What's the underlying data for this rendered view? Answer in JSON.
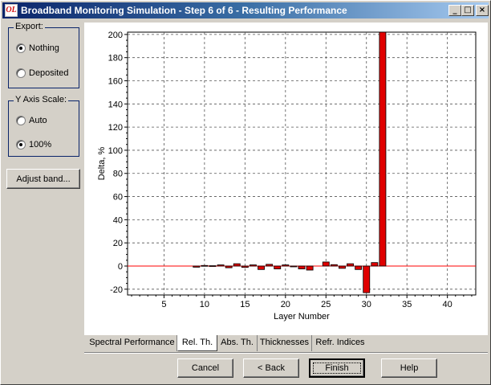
{
  "window": {
    "title": "Broadband Monitoring Simulation - Step 6 of 6 - Resulting Performance",
    "icon_text": "OL",
    "controls": {
      "minimize": "_",
      "maximize": "□",
      "close": "×"
    }
  },
  "export_group": {
    "label": "Export:",
    "options": [
      {
        "label": "Nothing",
        "checked": true
      },
      {
        "label": "Deposited",
        "checked": false
      }
    ]
  },
  "yaxis_group": {
    "label": "Y Axis Scale:",
    "options": [
      {
        "label": "Auto",
        "checked": false
      },
      {
        "label": "100%",
        "checked": true
      }
    ]
  },
  "adjust_button": "Adjust band...",
  "tabs": [
    {
      "label": "Spectral Performance",
      "active": false
    },
    {
      "label": "Rel. Th.",
      "active": true
    },
    {
      "label": "Abs. Th.",
      "active": false
    },
    {
      "label": "Thicknesses",
      "active": false
    },
    {
      "label": "Refr. Indices",
      "active": false
    }
  ],
  "buttons": {
    "cancel": "Cancel",
    "back": "< Back",
    "finish": "Finish",
    "help": "Help"
  },
  "colors": {
    "bar_fill": "#e00000",
    "zero_line": "#ff0000",
    "title_bar": "#0a246a"
  },
  "chart_data": {
    "type": "bar",
    "xlabel": "Layer Number",
    "ylabel": "Delta, %",
    "xlim": [
      0.5,
      43.5
    ],
    "ylim": [
      -25,
      202
    ],
    "xticks": [
      5,
      10,
      15,
      20,
      25,
      30,
      35,
      40
    ],
    "yticks": [
      -20,
      0,
      20,
      40,
      60,
      80,
      100,
      120,
      140,
      160,
      180,
      200
    ],
    "grid": true,
    "series": [
      {
        "x": [
          1,
          2,
          3,
          4,
          5,
          6,
          7,
          8,
          9,
          10,
          11,
          12,
          13,
          14,
          15,
          16,
          17,
          18,
          19,
          20,
          21,
          22,
          23,
          24,
          25,
          26,
          27,
          28,
          29,
          30,
          31,
          32,
          33,
          34,
          35,
          36,
          37,
          38,
          39,
          40,
          41,
          42,
          43
        ],
        "values": [
          0,
          0,
          0,
          0,
          0,
          0,
          0,
          0,
          -1,
          0.5,
          0.3,
          1,
          -1.5,
          2,
          -1.2,
          1,
          -3,
          1.5,
          -2.5,
          1,
          -0.3,
          -2.5,
          -3.5,
          0,
          3.5,
          1.2,
          -2,
          2,
          -3,
          -23,
          3,
          202,
          0,
          0,
          0,
          0,
          0,
          0,
          0,
          0,
          0,
          0,
          0
        ]
      }
    ]
  }
}
